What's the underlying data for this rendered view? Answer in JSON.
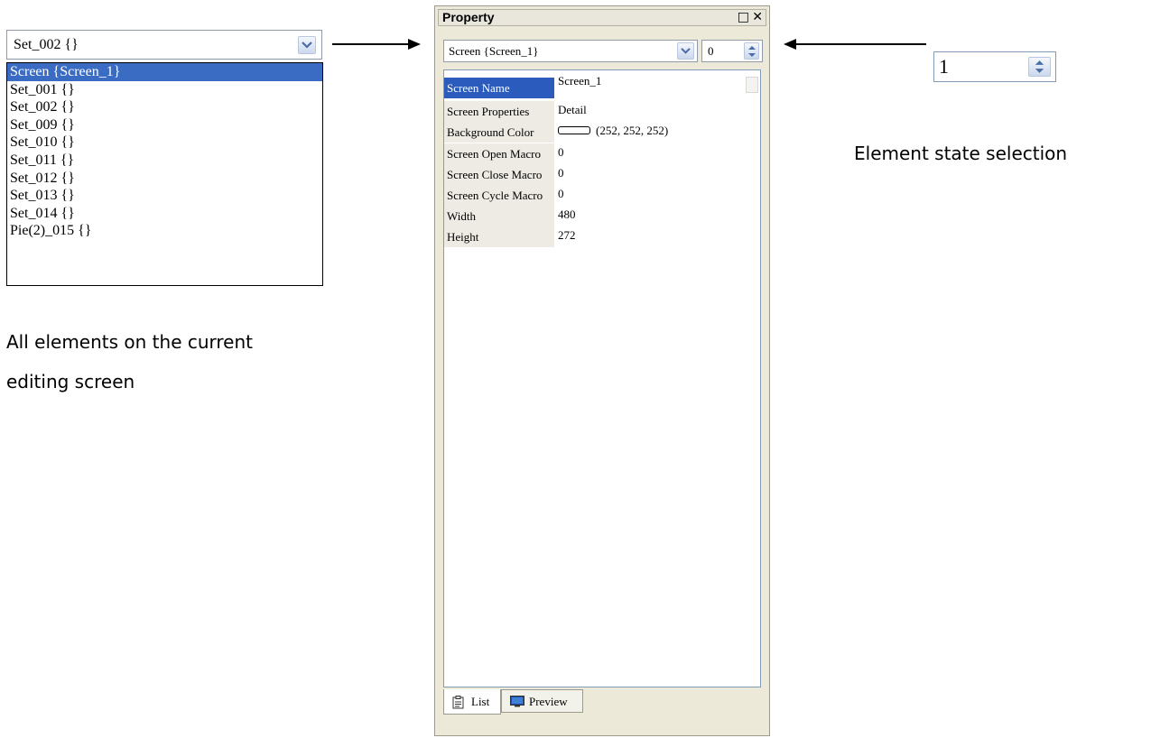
{
  "left_panel": {
    "dropdown_value": "Set_002 {}",
    "items": [
      "Screen {Screen_1}",
      "Set_001 {}",
      "Set_002 {}",
      "Set_009 {}",
      "Set_010 {}",
      "Set_011 {}",
      "Set_012 {}",
      "Set_013 {}",
      "Set_014 {}",
      "Pie(2)_015 {}"
    ],
    "selected_index": 0,
    "caption_line1": "All elements on the current",
    "caption_line2": "editing screen"
  },
  "property_window": {
    "title": "Property",
    "restore_glyph": "□",
    "close_glyph": "✕",
    "element_combo_value": "Screen {Screen_1}",
    "state_spin_value": "0",
    "properties": [
      {
        "label": "Screen Name",
        "value": "Screen_1"
      },
      {
        "label": "Screen Properties",
        "value": "Detail"
      },
      {
        "label": "Background Color",
        "value": "(252, 252, 252)"
      },
      {
        "label": "Screen Open Macro",
        "value": "0"
      },
      {
        "label": "Screen Close Macro",
        "value": "0"
      },
      {
        "label": "Screen Cycle Macro",
        "value": "0"
      },
      {
        "label": "Width",
        "value": "480"
      },
      {
        "label": "Height",
        "value": "272"
      }
    ],
    "background_color_swatch": "#fcfcfc",
    "tabs": {
      "list": "List",
      "preview": "Preview"
    }
  },
  "right_panel": {
    "spin_value": "1",
    "caption": "Element state selection"
  },
  "colors": {
    "selection": "#3a6cc4",
    "active_label": "#2a5bbd",
    "window_bg": "#ece9d8"
  },
  "icons": [
    "chevron-down-icon",
    "spin-up-icon",
    "spin-down-icon",
    "arrow-right-icon",
    "arrow-left-icon",
    "clipboard-icon",
    "monitor-icon"
  ]
}
